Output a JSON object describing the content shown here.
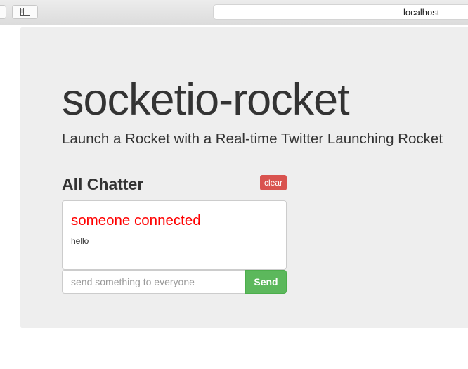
{
  "browser": {
    "address": "localhost",
    "sidebar_toggle_icon": "sidebar-icon"
  },
  "page": {
    "title": "socketio-rocket",
    "subtitle": "Launch a Rocket with a Real-time Twitter Launching Rocket"
  },
  "chatter": {
    "heading": "All Chatter",
    "clear_label": "clear",
    "messages": [
      {
        "text": "someone connected",
        "style": "status"
      },
      {
        "text": "hello",
        "style": "message"
      }
    ],
    "input_placeholder": "send something to everyone",
    "input_value": "",
    "send_label": "Send"
  },
  "colors": {
    "jumbotron_bg": "#eeeeee",
    "danger": "#d9534f",
    "success": "#5cb85c",
    "status_text": "#ff0000",
    "text": "#333333"
  }
}
